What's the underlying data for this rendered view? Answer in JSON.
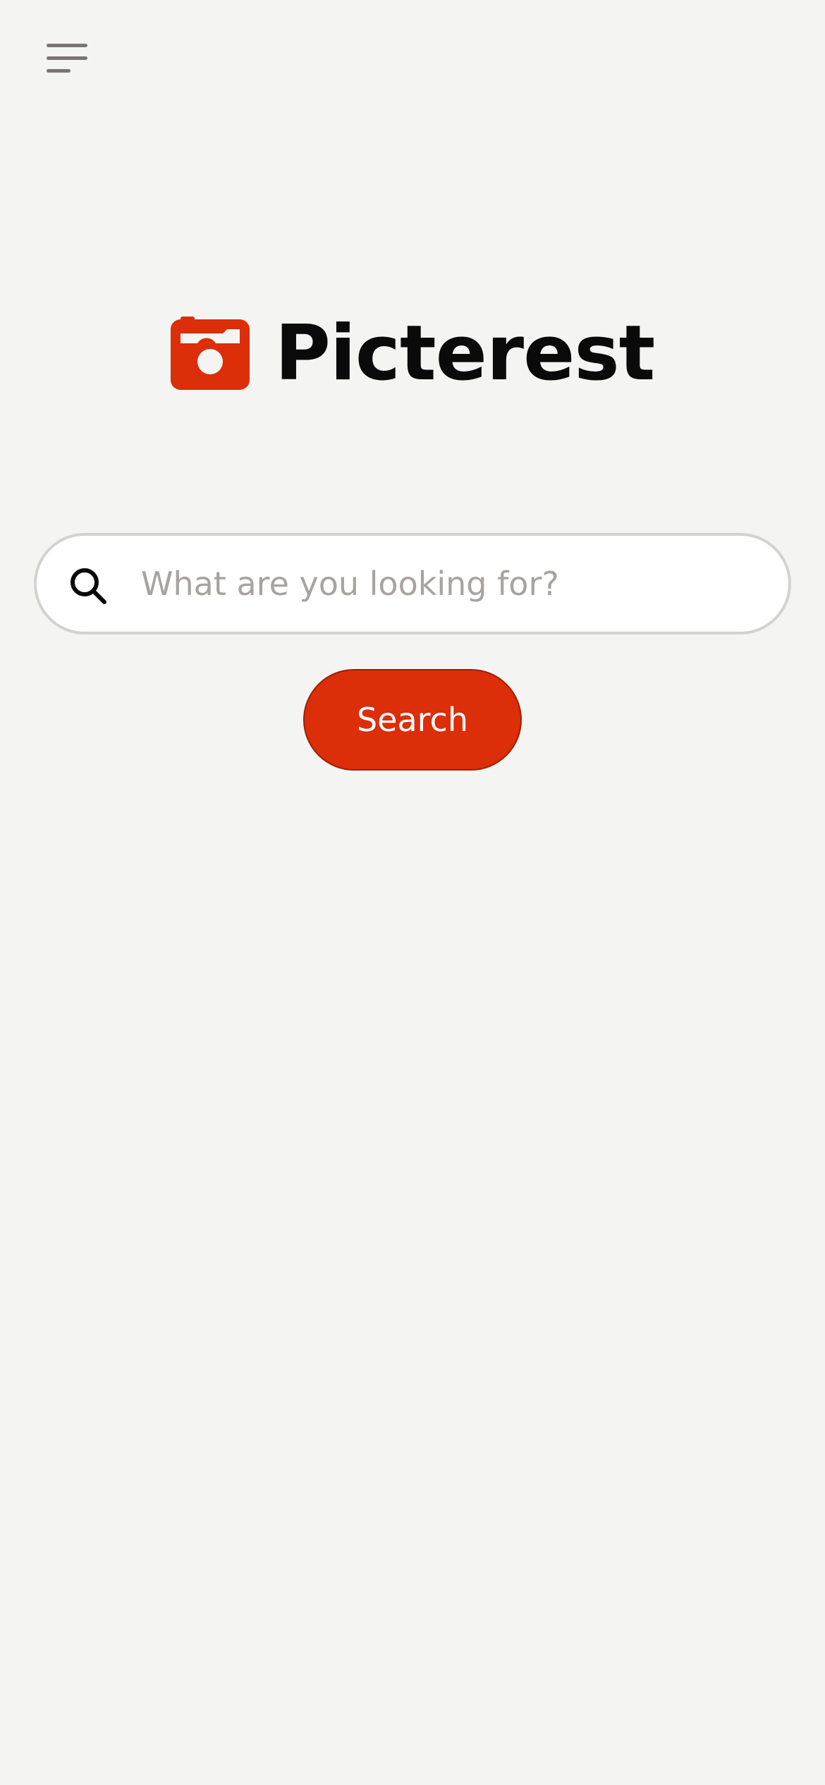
{
  "header": {
    "menu_icon": "hamburger-menu-icon"
  },
  "brand": {
    "logo_icon": "camera-icon",
    "name": "Picterest",
    "accent_color": "#dc2e08"
  },
  "search": {
    "icon": "search-icon",
    "placeholder": "What are you looking for?",
    "value": "",
    "button_label": "Search"
  }
}
